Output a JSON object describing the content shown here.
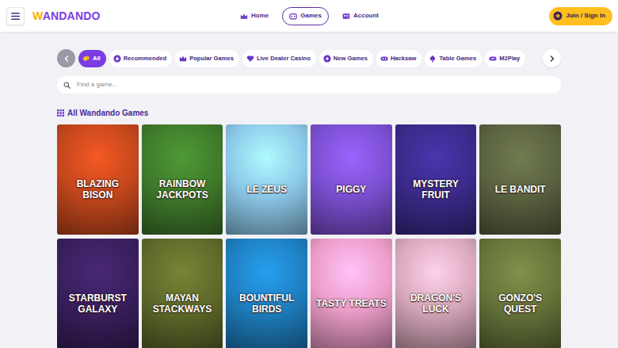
{
  "header": {
    "logo": "WANDANDO",
    "nav": [
      {
        "label": "Home",
        "selected": false
      },
      {
        "label": "Games",
        "selected": true
      },
      {
        "label": "Account",
        "selected": false
      }
    ],
    "auth_button": "Join / Sign In"
  },
  "categories": [
    {
      "label": "All",
      "selected": true
    },
    {
      "label": "Recommended",
      "selected": false
    },
    {
      "label": "Popular Games",
      "selected": false
    },
    {
      "label": "Live Dealer Casino",
      "selected": false
    },
    {
      "label": "New Games",
      "selected": false
    },
    {
      "label": "Hacksaw",
      "selected": false
    },
    {
      "label": "Table Games",
      "selected": false
    },
    {
      "label": "M2Play",
      "selected": false
    }
  ],
  "search": {
    "placeholder": "Find a game..."
  },
  "section": {
    "title": "All Wandando Games"
  },
  "games": [
    {
      "title": "BLAZING BISON",
      "color": "#c4471c"
    },
    {
      "title": "RAINBOW JACKPOTS",
      "color": "#3f7a2a"
    },
    {
      "title": "LE ZEUS",
      "color": "#8cc8e8"
    },
    {
      "title": "PIGGY",
      "color": "#7b4fd0"
    },
    {
      "title": "MYSTERY FRUIT",
      "color": "#3b2a8a"
    },
    {
      "title": "LE BANDIT",
      "color": "#5a6240"
    },
    {
      "title": "STARBURST GALAXY",
      "color": "#3a1f5e"
    },
    {
      "title": "MAYAN STACKWAYS",
      "color": "#5e6a2a"
    },
    {
      "title": "BOUNTIFUL BIRDS",
      "color": "#1e7fc0"
    },
    {
      "title": "TASTY TREATS",
      "color": "#ec9cc8"
    },
    {
      "title": "DRAGON'S LUCK",
      "color": "#d8a8bc"
    },
    {
      "title": "GONZO'S QUEST",
      "color": "#66743a"
    }
  ]
}
